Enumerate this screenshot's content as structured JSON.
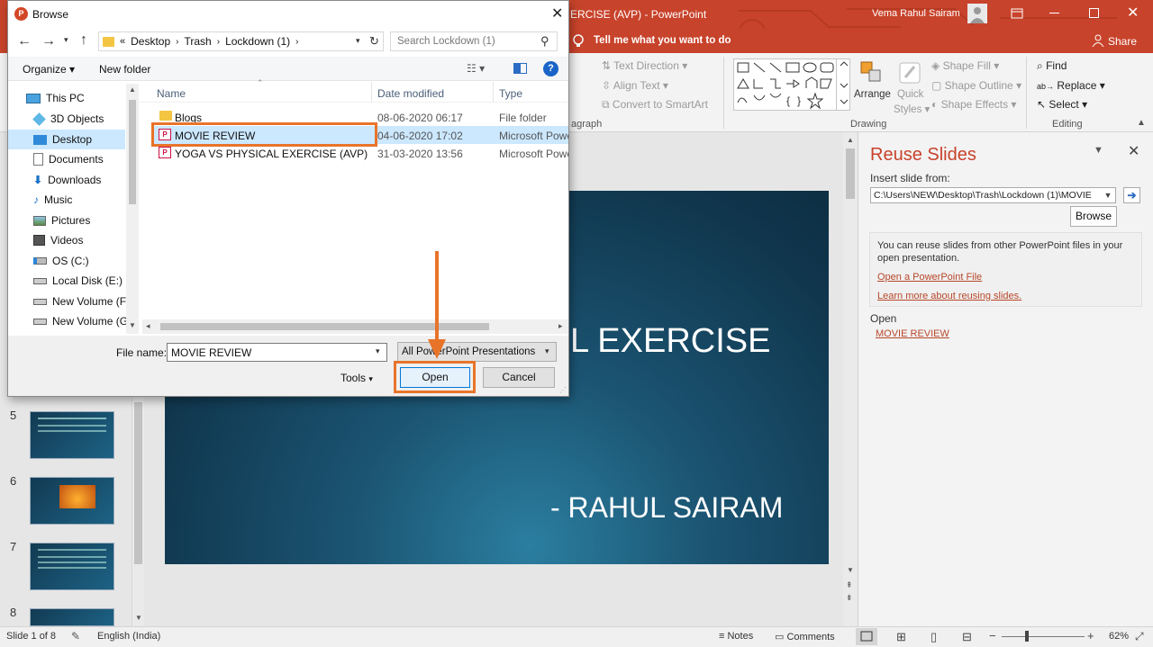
{
  "powerpoint": {
    "title": "YOGA VS PHYSICAL EXERCISE (AVP)  -  PowerPoint",
    "title_visible": "ERCISE (AVP)  -  PowerPoint",
    "user_name": "Vema Rahul Sairam",
    "tell_me": "Tell me what you want to do",
    "share": "Share",
    "ribbon": {
      "text_direction": "Text Direction",
      "align_text": "Align Text",
      "convert_smartart": "Convert to SmartArt",
      "paragraph_group": "agraph",
      "arrange": "Arrange",
      "quick_styles_1": "Quick",
      "quick_styles_2": "Styles",
      "shape_fill": "Shape Fill",
      "shape_outline": "Shape Outline",
      "shape_effects": "Shape Effects",
      "drawing_group": "Drawing",
      "find": "Find",
      "replace": "Replace",
      "select": "Select",
      "editing_group": "Editing"
    },
    "thumbnails": [
      {
        "num": "5"
      },
      {
        "num": "6"
      },
      {
        "num": "7"
      },
      {
        "num": "8"
      }
    ],
    "slide": {
      "title_visible": "L EXERCISE",
      "subtitle": "- RAHUL SAIRAM"
    },
    "reuse": {
      "title": "Reuse Slides",
      "insert_label": "Insert slide from:",
      "path": "C:\\Users\\NEW\\Desktop\\Trash\\Lockdown (1)\\MOVIE",
      "browse": "Browse",
      "info": "You can reuse slides from other PowerPoint files in your open presentation.",
      "open_link": "Open a PowerPoint File",
      "learn_link": "Learn more about reusing slides.",
      "open_label": "Open",
      "recent_file": "MOVIE REVIEW"
    },
    "status": {
      "slide_info": "Slide 1 of 8",
      "language": "English (India)",
      "notes": "Notes",
      "comments": "Comments",
      "zoom": "62%"
    }
  },
  "dialog": {
    "title": "Browse",
    "breadcrumb": [
      "Desktop",
      "Trash",
      "Lockdown (1)"
    ],
    "search_placeholder": "Search Lockdown (1)",
    "organize": "Organize",
    "new_folder": "New folder",
    "nav_items": [
      {
        "label": "This PC",
        "icon": "computer-icon"
      },
      {
        "label": "3D Objects",
        "icon": "cube-icon"
      },
      {
        "label": "Desktop",
        "icon": "desktop-icon",
        "selected": true
      },
      {
        "label": "Documents",
        "icon": "document-icon"
      },
      {
        "label": "Downloads",
        "icon": "download-icon"
      },
      {
        "label": "Music",
        "icon": "music-icon"
      },
      {
        "label": "Pictures",
        "icon": "pictures-icon"
      },
      {
        "label": "Videos",
        "icon": "video-icon"
      },
      {
        "label": "OS (C:)",
        "icon": "drive-icon"
      },
      {
        "label": "Local Disk (E:)",
        "icon": "drive-icon"
      },
      {
        "label": "New Volume (F:)",
        "icon": "drive-icon"
      },
      {
        "label": "New Volume (G:",
        "icon": "drive-icon"
      }
    ],
    "columns": {
      "name": "Name",
      "date": "Date modified",
      "type": "Type"
    },
    "files": [
      {
        "name": "Blogs",
        "date": "08-06-2020 06:17",
        "type": "File folder",
        "icon": "folder-icon"
      },
      {
        "name": "MOVIE REVIEW",
        "date": "04-06-2020 17:02",
        "type": "Microsoft Powe",
        "icon": "powerpoint-file-icon",
        "selected": true
      },
      {
        "name": "YOGA VS PHYSICAL EXERCISE (AVP)",
        "date": "31-03-2020 13:56",
        "type": "Microsoft Powe",
        "icon": "powerpoint-file-icon"
      }
    ],
    "filename_label": "File name:",
    "filename_value": "MOVIE REVIEW",
    "filter": "All PowerPoint Presentations",
    "tools": "Tools",
    "open": "Open",
    "cancel": "Cancel"
  },
  "colors": {
    "accent": "#c8432b",
    "highlight": "#e8742a",
    "selection": "#cce8ff",
    "link": "#b7472a"
  }
}
